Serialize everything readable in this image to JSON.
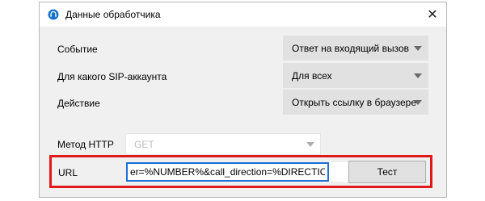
{
  "window": {
    "title": "Данные обработчика",
    "app_icon": "headset-icon",
    "close_icon": "close-icon",
    "close_label": "✕",
    "accent_color": "#1e6fd6",
    "highlight_color": "#e01a1a"
  },
  "form": {
    "event": {
      "label": "Событие",
      "value": "Ответ на входящий вызов"
    },
    "sip_account": {
      "label": "Для какого SIP-аккаунта",
      "value": "Для всех"
    },
    "action": {
      "label": "Действие",
      "value": "Открыть ссылку в браузере"
    },
    "http_method": {
      "label": "Метод HTTP",
      "value": "GET",
      "disabled": true
    },
    "url": {
      "label": "URL",
      "value": "er=%NUMBER%&call_direction=%DIRECTION%"
    },
    "test_button": "Тест"
  }
}
